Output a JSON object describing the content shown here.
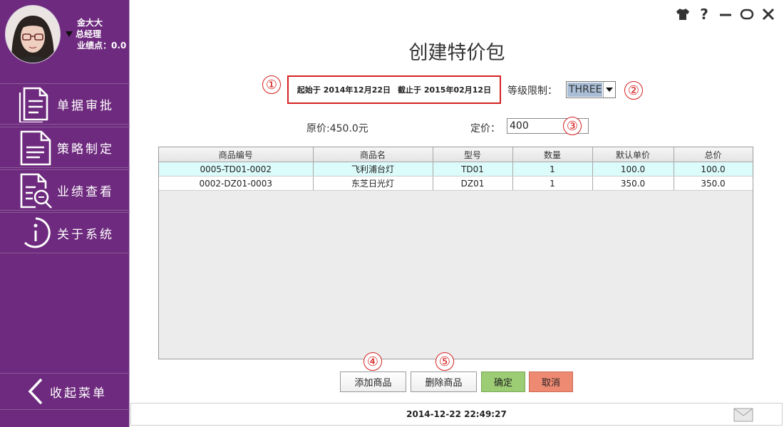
{
  "user": {
    "name": "金大大",
    "role": "总经理",
    "points_label": "业绩点：0.0"
  },
  "sidebar": {
    "items": [
      {
        "label": "单据审批",
        "icon": "document-icon"
      },
      {
        "label": "策略制定",
        "icon": "document-lines-icon"
      },
      {
        "label": "业绩查看",
        "icon": "document-search-icon"
      },
      {
        "label": "关于系统",
        "icon": "info-icon"
      }
    ],
    "collapse_label": "收起菜单"
  },
  "window_icons": [
    "shirt-icon",
    "help-icon",
    "minimize-icon",
    "maximize-icon",
    "close-icon"
  ],
  "page": {
    "title": "创建特价包",
    "start_label": "起始于",
    "start_date": "2014年12月22日",
    "end_label": "截止于",
    "end_date": "2015年02月12日",
    "level_label": "等级限制：",
    "level_value": "THREE",
    "original_price": "原价:450.0元",
    "price_label": "定价：",
    "price_value": "400"
  },
  "markers": [
    "①",
    "②",
    "③",
    "④",
    "⑤"
  ],
  "table": {
    "columns": [
      "商品编号",
      "商品名",
      "型号",
      "数量",
      "默认单价",
      "总价"
    ],
    "rows": [
      [
        "0005-TD01-0002",
        "飞利浦台灯",
        "TD01",
        "1",
        "100.0",
        "100.0"
      ],
      [
        "0002-DZ01-0003",
        "东芝日光灯",
        "DZ01",
        "1",
        "350.0",
        "350.0"
      ]
    ]
  },
  "buttons": {
    "add": "添加商品",
    "delete": "删除商品",
    "ok": "确定",
    "cancel": "取消"
  },
  "status": {
    "datetime": "2014-12-22 22:49:27"
  },
  "colors": {
    "sidebar": "#6e2a7e",
    "marker": "#d52020",
    "ok": "#9ccd74",
    "cancel": "#ef8a72",
    "selected_row": "#dcfbfb"
  }
}
